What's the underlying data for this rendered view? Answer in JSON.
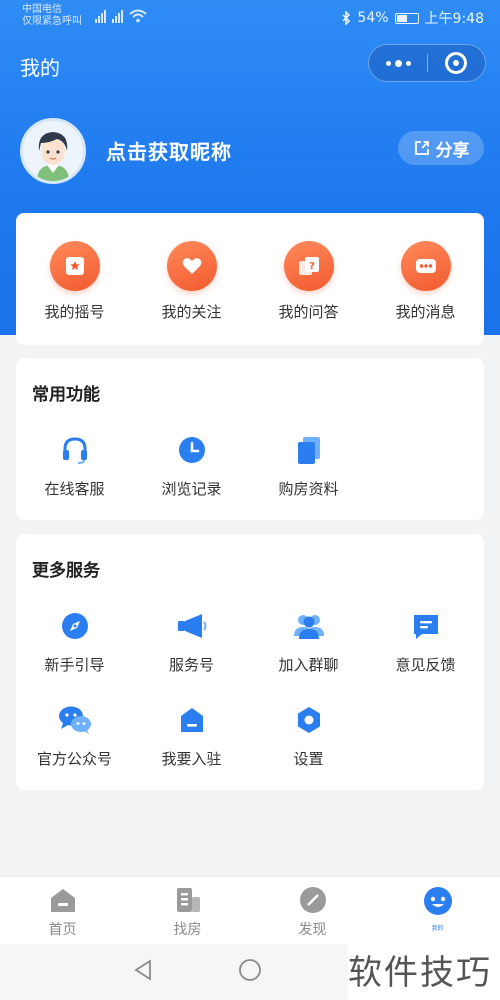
{
  "status_bar": {
    "carrier_line1": "中国电信",
    "carrier_line2": "仅限紧急呼叫",
    "battery": "54%",
    "time": "上午9:48"
  },
  "header": {
    "title": "我的"
  },
  "profile": {
    "nickname": "点击获取昵称",
    "share_label": "分享"
  },
  "quick_actions": [
    {
      "label": "我的摇号",
      "icon": "lottery-icon"
    },
    {
      "label": "我的关注",
      "icon": "heart-icon"
    },
    {
      "label": "我的问答",
      "icon": "qa-icon"
    },
    {
      "label": "我的消息",
      "icon": "message-icon"
    }
  ],
  "common_functions": {
    "title": "常用功能",
    "items": [
      {
        "label": "在线客服",
        "icon": "headset-icon"
      },
      {
        "label": "浏览记录",
        "icon": "clock-icon"
      },
      {
        "label": "购房资料",
        "icon": "documents-icon"
      }
    ]
  },
  "more_services": {
    "title": "更多服务",
    "items": [
      {
        "label": "新手引导",
        "icon": "compass-icon"
      },
      {
        "label": "服务号",
        "icon": "megaphone-icon"
      },
      {
        "label": "加入群聊",
        "icon": "group-icon"
      },
      {
        "label": "意见反馈",
        "icon": "feedback-icon"
      },
      {
        "label": "官方公众号",
        "icon": "wechat-icon"
      },
      {
        "label": "我要入驻",
        "icon": "register-icon"
      },
      {
        "label": "设置",
        "icon": "settings-icon"
      }
    ]
  },
  "tabbar": [
    {
      "label": "首页",
      "icon": "home-icon",
      "active": false
    },
    {
      "label": "找房",
      "icon": "building-icon",
      "active": false
    },
    {
      "label": "发现",
      "icon": "discover-icon",
      "active": false
    },
    {
      "label": "我的",
      "icon": "profile-icon",
      "active": true
    }
  ],
  "watermark": "软件技巧",
  "colors": {
    "primary": "#1d78ee",
    "accent": "#f25a2e",
    "icon_blue": "#2a7ef0"
  }
}
